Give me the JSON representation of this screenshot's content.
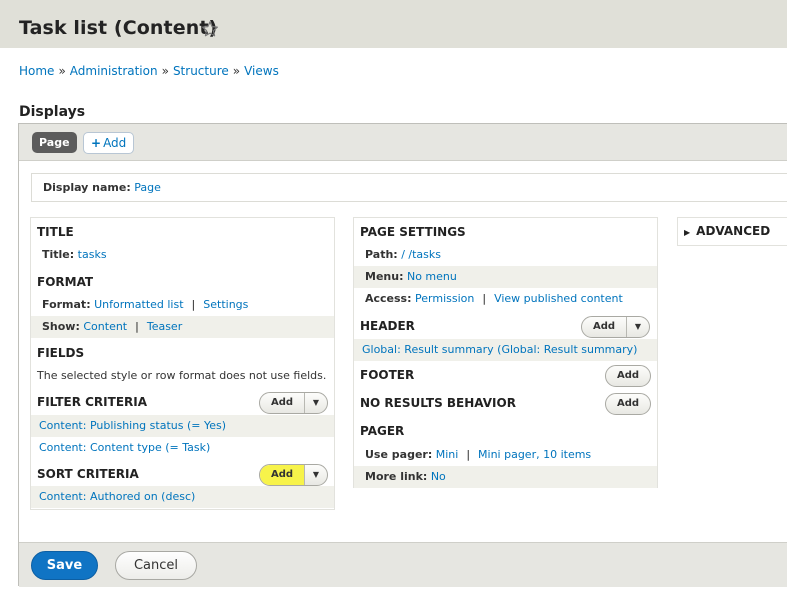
{
  "page": {
    "title": "Task list (Content)"
  },
  "breadcrumb": [
    "Home",
    "Administration",
    "Structure",
    "Views"
  ],
  "breadcrumb_sep": "»",
  "displays": {
    "heading": "Displays",
    "tabs": {
      "page": "Page",
      "add": "Add"
    },
    "display_name_label": "Display name:",
    "display_name_value": "Page"
  },
  "col1": {
    "title": {
      "heading": "TITLE",
      "label": "Title:",
      "value": "tasks"
    },
    "format": {
      "heading": "FORMAT",
      "format_label": "Format:",
      "format_value": "Unformatted list",
      "format_settings": "Settings",
      "show_label": "Show:",
      "show_value": "Content",
      "show_settings": "Teaser"
    },
    "fields": {
      "heading": "FIELDS",
      "text": "The selected style or row format does not use fields."
    },
    "filter": {
      "heading": "FILTER CRITERIA",
      "items": [
        "Content: Publishing status (= Yes)",
        "Content: Content type (= Task)"
      ],
      "add": "Add"
    },
    "sort": {
      "heading": "SORT CRITERIA",
      "items": [
        "Content: Authored on (desc)"
      ],
      "add": "Add"
    }
  },
  "col2": {
    "page_settings": {
      "heading": "PAGE SETTINGS",
      "path_label": "Path:",
      "path_value": "/ /tasks",
      "menu_label": "Menu:",
      "menu_value": "No menu",
      "access_label": "Access:",
      "access_value": "Permission",
      "access_settings": "View published content"
    },
    "header": {
      "heading": "HEADER",
      "item": "Global: Result summary (Global: Result summary)",
      "add": "Add"
    },
    "footer": {
      "heading": "FOOTER",
      "add": "Add"
    },
    "no_results": {
      "heading": "NO RESULTS BEHAVIOR",
      "add": "Add"
    },
    "pager": {
      "heading": "PAGER",
      "use_label": "Use pager:",
      "use_value": "Mini",
      "use_settings": "Mini pager, 10 items",
      "more_label": "More link:",
      "more_value": "No"
    }
  },
  "col3": {
    "advanced": "ADVANCED"
  },
  "actions": {
    "save": "Save",
    "cancel": "Cancel"
  },
  "icons": {
    "star": "star-outline-icon",
    "plus": "plus-icon",
    "dropdown": "caret-down-icon",
    "expand": "triangle-right-icon"
  },
  "colors": {
    "link": "#0074bd",
    "save": "#1074c4",
    "highlight": "#ffff8a"
  }
}
